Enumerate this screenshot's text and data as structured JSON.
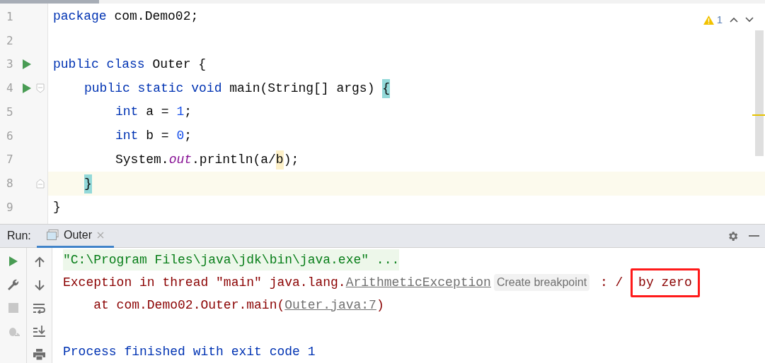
{
  "editor": {
    "warnings": {
      "count": "1"
    },
    "lines": [
      {
        "number": "1",
        "tokens": [
          {
            "kind": "keyword",
            "text": "package"
          },
          {
            "kind": "plain",
            "text": " com.Demo02;"
          }
        ]
      },
      {
        "number": "2"
      },
      {
        "number": "3",
        "run": true,
        "tokens": [
          {
            "kind": "keyword",
            "text": "public class"
          },
          {
            "kind": "plain",
            "text": " Outer {"
          }
        ]
      },
      {
        "number": "4",
        "run": true,
        "fold_start": true,
        "tokens": [
          {
            "kind": "indent"
          },
          {
            "kind": "keyword",
            "text": "public static void"
          },
          {
            "kind": "plain",
            "text": " main(String[] args) "
          },
          {
            "kind": "match",
            "text": "{"
          }
        ]
      },
      {
        "number": "5",
        "tokens": [
          {
            "kind": "indent"
          },
          {
            "kind": "indent"
          },
          {
            "kind": "keyword",
            "text": "int"
          },
          {
            "kind": "plain",
            "text": " a = "
          },
          {
            "kind": "number",
            "text": "1"
          },
          {
            "kind": "plain",
            "text": ";"
          }
        ]
      },
      {
        "number": "6",
        "tokens": [
          {
            "kind": "indent"
          },
          {
            "kind": "indent"
          },
          {
            "kind": "keyword",
            "text": "int"
          },
          {
            "kind": "plain",
            "text": " b = "
          },
          {
            "kind": "number",
            "text": "0"
          },
          {
            "kind": "plain",
            "text": ";"
          }
        ]
      },
      {
        "number": "7",
        "tokens": [
          {
            "kind": "indent"
          },
          {
            "kind": "indent"
          },
          {
            "kind": "plain",
            "text": "System."
          },
          {
            "kind": "field",
            "text": "out"
          },
          {
            "kind": "plain",
            "text": ".println(a/"
          },
          {
            "kind": "caret",
            "text": "b"
          },
          {
            "kind": "plain",
            "text": ");"
          }
        ]
      },
      {
        "number": "8",
        "fold_end": true,
        "current": true,
        "tokens": [
          {
            "kind": "indent"
          },
          {
            "kind": "match",
            "text": "}"
          }
        ]
      },
      {
        "number": "9",
        "tokens": [
          {
            "kind": "plain",
            "text": "}"
          }
        ]
      }
    ]
  },
  "run_panel": {
    "label": "Run:",
    "tabs": [
      {
        "label": "Outer",
        "selected": true
      }
    ],
    "console": [
      {
        "kind": "command",
        "segments": [
          {
            "kind": "text",
            "text": "\"C:\\Program Files\\java\\jdk\\bin\\java.exe\" ..."
          }
        ]
      },
      {
        "kind": "error",
        "segments": [
          {
            "kind": "text",
            "text": "Exception in thread \"main\" java.lang."
          },
          {
            "kind": "link",
            "text": "ArithmeticException"
          },
          {
            "kind": "hint",
            "text": "Create breakpoint"
          },
          {
            "kind": "text",
            "text": " : / "
          },
          {
            "kind": "boxed",
            "text": "by zero"
          }
        ]
      },
      {
        "kind": "error",
        "segments": [
          {
            "kind": "text",
            "text": "    at com.Demo02.Outer.main("
          },
          {
            "kind": "link",
            "text": "Outer.java:7"
          },
          {
            "kind": "text",
            "text": ")"
          }
        ]
      },
      {
        "kind": "exit",
        "segments": [
          {
            "kind": "text",
            "text": "Process finished with exit code 1"
          }
        ]
      }
    ]
  }
}
